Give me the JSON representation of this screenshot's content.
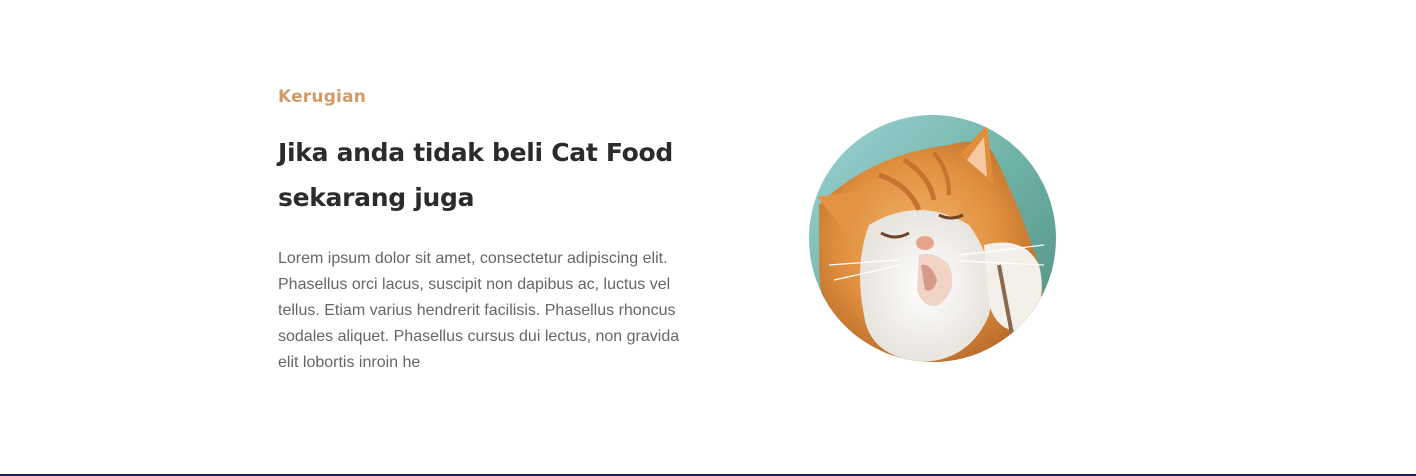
{
  "section": {
    "eyebrow": "Kerugian",
    "headline": "Jika anda tidak beli Cat Food sekarang juga",
    "body": "Lorem ipsum dolor sit amet, consectetur adipiscing elit. Phasellus orci lacus, suscipit non dapibus ac, luctus vel tellus. Etiam varius hendrerit facilisis. Phasellus rhoncus sodales aliquet. Phasellus cursus dui lectus, non gravida elit lobortis inroin he"
  },
  "colors": {
    "eyebrow": "#d19a66",
    "headline": "#2b2b2b",
    "body": "#666666",
    "bottom_rule": "#1a1f5c"
  },
  "image": {
    "subject": "orange-white-cat-licking-paw"
  }
}
